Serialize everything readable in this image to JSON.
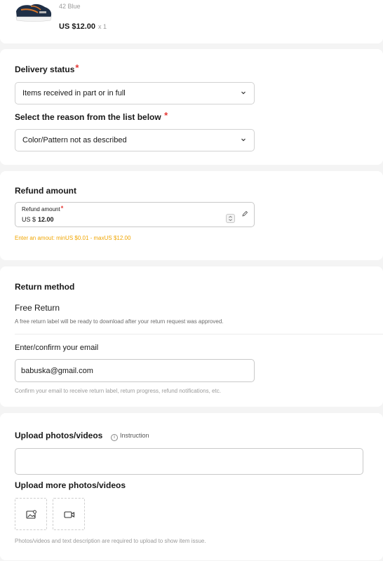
{
  "product": {
    "sku": "42 Blue",
    "price": "US $12.00",
    "quantity": "x 1",
    "thumbnail_icon": "sneaker-image"
  },
  "delivery": {
    "title": "Delivery status",
    "required_mark": "*",
    "status_value": "Items received in part or in full",
    "reason_title": "Select the reason from the list below",
    "reason_value": "Color/Pattern not as described"
  },
  "refund": {
    "title": "Refund amount",
    "field_label": "Refund amount",
    "currency": "US $",
    "amount": "12.00",
    "hint": "Enter an amout: minUS $0.01 - maxUS $12.00"
  },
  "return_method": {
    "title": "Return method",
    "option": "Free Return",
    "option_desc": "A free return label will be ready to download after your return request was approved.",
    "email_label": "Enter/confirm your email",
    "email_value": "babuska@gmail.com",
    "email_hint": "Confirm your email to receive return label, return progress, refund notifications, etc."
  },
  "upload": {
    "title": "Upload photos/videos",
    "instruction": "Instruction",
    "more_title": "Upload more photos/videos",
    "footer": "Photos/videos and text description are required to upload to show item issue."
  },
  "colors": {
    "accent_required": "#e53935",
    "hint_warning": "#f0a500"
  }
}
